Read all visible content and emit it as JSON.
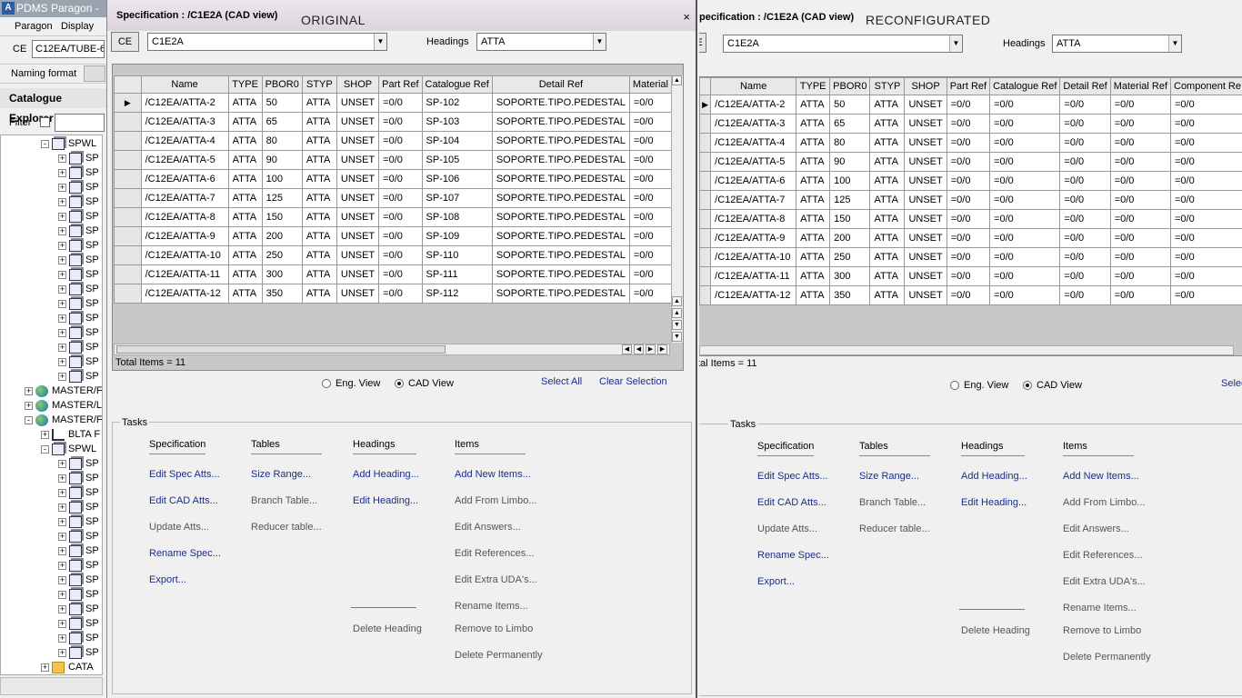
{
  "app": {
    "title": "PDMS Paragon -",
    "logo": "A",
    "menu": [
      "Paragon",
      "Display"
    ],
    "ce_label": "CE",
    "ce_value": "C12EA/TUBE-6",
    "naming_format": "Naming format",
    "explorer_title": "Catalogue Explorer",
    "filter_label": "Filter",
    "tree": [
      {
        "label": "SPWL",
        "level": 2,
        "icon": "spec-icon",
        "sign": "-"
      },
      {
        "label": "SP",
        "level": 3,
        "icon": "spec-icon",
        "sign": "+"
      },
      {
        "label": "SP",
        "level": 3,
        "icon": "spec-icon",
        "sign": "+"
      },
      {
        "label": "SP",
        "level": 3,
        "icon": "spec-icon",
        "sign": "+"
      },
      {
        "label": "SP",
        "level": 3,
        "icon": "spec-icon",
        "sign": "+"
      },
      {
        "label": "SP",
        "level": 3,
        "icon": "spec-icon",
        "sign": "+"
      },
      {
        "label": "SP",
        "level": 3,
        "icon": "spec-icon",
        "sign": "+"
      },
      {
        "label": "SP",
        "level": 3,
        "icon": "spec-icon",
        "sign": "+"
      },
      {
        "label": "SP",
        "level": 3,
        "icon": "spec-icon",
        "sign": "+"
      },
      {
        "label": "SP",
        "level": 3,
        "icon": "spec-icon",
        "sign": "+"
      },
      {
        "label": "SP",
        "level": 3,
        "icon": "spec-icon",
        "sign": "+"
      },
      {
        "label": "SP",
        "level": 3,
        "icon": "spec-icon",
        "sign": "+"
      },
      {
        "label": "SP",
        "level": 3,
        "icon": "spec-icon",
        "sign": "+"
      },
      {
        "label": "SP",
        "level": 3,
        "icon": "spec-icon",
        "sign": "+"
      },
      {
        "label": "SP",
        "level": 3,
        "icon": "spec-icon",
        "sign": "+"
      },
      {
        "label": "SP",
        "level": 3,
        "icon": "spec-icon",
        "sign": "+"
      },
      {
        "label": "SP",
        "level": 3,
        "icon": "spec-icon",
        "sign": "+"
      },
      {
        "label": "MASTER/F",
        "level": 1,
        "icon": "globe-icon",
        "sign": "+"
      },
      {
        "label": "MASTER/L",
        "level": 1,
        "icon": "globe-icon",
        "sign": "+"
      },
      {
        "label": "MASTER/F",
        "level": 1,
        "icon": "globe-icon",
        "sign": "-"
      },
      {
        "label": "BLTA F",
        "level": 2,
        "icon": "hierarchy-icon",
        "sign": "+"
      },
      {
        "label": "SPWL",
        "level": 2,
        "icon": "spec-icon",
        "sign": "-"
      },
      {
        "label": "SP",
        "level": 3,
        "icon": "spec-icon",
        "sign": "+"
      },
      {
        "label": "SP",
        "level": 3,
        "icon": "spec-icon",
        "sign": "+"
      },
      {
        "label": "SP",
        "level": 3,
        "icon": "spec-icon",
        "sign": "+"
      },
      {
        "label": "SP",
        "level": 3,
        "icon": "spec-icon",
        "sign": "+"
      },
      {
        "label": "SP",
        "level": 3,
        "icon": "spec-icon",
        "sign": "+"
      },
      {
        "label": "SP",
        "level": 3,
        "icon": "spec-icon",
        "sign": "+"
      },
      {
        "label": "SP",
        "level": 3,
        "icon": "spec-icon",
        "sign": "+"
      },
      {
        "label": "SP",
        "level": 3,
        "icon": "spec-icon",
        "sign": "+"
      },
      {
        "label": "SP",
        "level": 3,
        "icon": "spec-icon",
        "sign": "+"
      },
      {
        "label": "SP",
        "level": 3,
        "icon": "spec-icon",
        "sign": "+"
      },
      {
        "label": "SP",
        "level": 3,
        "icon": "spec-icon",
        "sign": "+"
      },
      {
        "label": "SP",
        "level": 3,
        "icon": "spec-icon",
        "sign": "+"
      },
      {
        "label": "SP",
        "level": 3,
        "icon": "spec-icon",
        "sign": "+"
      },
      {
        "label": "SP",
        "level": 3,
        "icon": "spec-icon",
        "sign": "+"
      },
      {
        "label": "CATA",
        "level": 2,
        "icon": "folder-icon",
        "sign": "+"
      }
    ]
  },
  "left": {
    "title": "Specification : /C1E2A (CAD view)",
    "overlay": "ORIGINAL",
    "close": "×",
    "ce_button": "CE",
    "spec_value": "C1E2A",
    "headings_label": "Headings",
    "headings_value": "ATTA",
    "columns": [
      "Name",
      "TYPE",
      "PBOR0",
      "STYP",
      "SHOP",
      "Part Ref",
      "Catalogue Ref",
      "Detail Ref",
      "Material"
    ],
    "rows": [
      [
        "/C12EA/ATTA-2",
        "ATTA",
        "50",
        "ATTA",
        "UNSET",
        "=0/0",
        "SP-102",
        "SOPORTE.TIPO.PEDESTAL",
        "=0/0"
      ],
      [
        "/C12EA/ATTA-3",
        "ATTA",
        "65",
        "ATTA",
        "UNSET",
        "=0/0",
        "SP-103",
        "SOPORTE.TIPO.PEDESTAL",
        "=0/0"
      ],
      [
        "/C12EA/ATTA-4",
        "ATTA",
        "80",
        "ATTA",
        "UNSET",
        "=0/0",
        "SP-104",
        "SOPORTE.TIPO.PEDESTAL",
        "=0/0"
      ],
      [
        "/C12EA/ATTA-5",
        "ATTA",
        "90",
        "ATTA",
        "UNSET",
        "=0/0",
        "SP-105",
        "SOPORTE.TIPO.PEDESTAL",
        "=0/0"
      ],
      [
        "/C12EA/ATTA-6",
        "ATTA",
        "100",
        "ATTA",
        "UNSET",
        "=0/0",
        "SP-106",
        "SOPORTE.TIPO.PEDESTAL",
        "=0/0"
      ],
      [
        "/C12EA/ATTA-7",
        "ATTA",
        "125",
        "ATTA",
        "UNSET",
        "=0/0",
        "SP-107",
        "SOPORTE.TIPO.PEDESTAL",
        "=0/0"
      ],
      [
        "/C12EA/ATTA-8",
        "ATTA",
        "150",
        "ATTA",
        "UNSET",
        "=0/0",
        "SP-108",
        "SOPORTE.TIPO.PEDESTAL",
        "=0/0"
      ],
      [
        "/C12EA/ATTA-9",
        "ATTA",
        "200",
        "ATTA",
        "UNSET",
        "=0/0",
        "SP-109",
        "SOPORTE.TIPO.PEDESTAL",
        "=0/0"
      ],
      [
        "/C12EA/ATTA-10",
        "ATTA",
        "250",
        "ATTA",
        "UNSET",
        "=0/0",
        "SP-110",
        "SOPORTE.TIPO.PEDESTAL",
        "=0/0"
      ],
      [
        "/C12EA/ATTA-11",
        "ATTA",
        "300",
        "ATTA",
        "UNSET",
        "=0/0",
        "SP-111",
        "SOPORTE.TIPO.PEDESTAL",
        "=0/0"
      ],
      [
        "/C12EA/ATTA-12",
        "ATTA",
        "350",
        "ATTA",
        "UNSET",
        "=0/0",
        "SP-112",
        "SOPORTE.TIPO.PEDESTAL",
        "=0/0"
      ]
    ],
    "total": "Total Items = 11",
    "eng_view": "Eng. View",
    "cad_view": "CAD View",
    "select_all": "Select All",
    "clear_selection": "Clear Selection"
  },
  "right": {
    "title": "pecification : /C1E2A (CAD view)",
    "overlay": "RECONFIGURATED",
    "ce_button": "E",
    "spec_value": "C1E2A",
    "headings_label": "Headings",
    "headings_value": "ATTA",
    "columns": [
      "Name",
      "TYPE",
      "PBOR0",
      "STYP",
      "SHOP",
      "Part Ref",
      "Catalogue Ref",
      "Detail Ref",
      "Material Ref",
      "Component Re"
    ],
    "rows": [
      [
        "/C12EA/ATTA-2",
        "ATTA",
        "50",
        "ATTA",
        "UNSET",
        "=0/0",
        "=0/0",
        "=0/0",
        "=0/0",
        "=0/0"
      ],
      [
        "/C12EA/ATTA-3",
        "ATTA",
        "65",
        "ATTA",
        "UNSET",
        "=0/0",
        "=0/0",
        "=0/0",
        "=0/0",
        "=0/0"
      ],
      [
        "/C12EA/ATTA-4",
        "ATTA",
        "80",
        "ATTA",
        "UNSET",
        "=0/0",
        "=0/0",
        "=0/0",
        "=0/0",
        "=0/0"
      ],
      [
        "/C12EA/ATTA-5",
        "ATTA",
        "90",
        "ATTA",
        "UNSET",
        "=0/0",
        "=0/0",
        "=0/0",
        "=0/0",
        "=0/0"
      ],
      [
        "/C12EA/ATTA-6",
        "ATTA",
        "100",
        "ATTA",
        "UNSET",
        "=0/0",
        "=0/0",
        "=0/0",
        "=0/0",
        "=0/0"
      ],
      [
        "/C12EA/ATTA-7",
        "ATTA",
        "125",
        "ATTA",
        "UNSET",
        "=0/0",
        "=0/0",
        "=0/0",
        "=0/0",
        "=0/0"
      ],
      [
        "/C12EA/ATTA-8",
        "ATTA",
        "150",
        "ATTA",
        "UNSET",
        "=0/0",
        "=0/0",
        "=0/0",
        "=0/0",
        "=0/0"
      ],
      [
        "/C12EA/ATTA-9",
        "ATTA",
        "200",
        "ATTA",
        "UNSET",
        "=0/0",
        "=0/0",
        "=0/0",
        "=0/0",
        "=0/0"
      ],
      [
        "/C12EA/ATTA-10",
        "ATTA",
        "250",
        "ATTA",
        "UNSET",
        "=0/0",
        "=0/0",
        "=0/0",
        "=0/0",
        "=0/0"
      ],
      [
        "/C12EA/ATTA-11",
        "ATTA",
        "300",
        "ATTA",
        "UNSET",
        "=0/0",
        "=0/0",
        "=0/0",
        "=0/0",
        "=0/0"
      ],
      [
        "/C12EA/ATTA-12",
        "ATTA",
        "350",
        "ATTA",
        "UNSET",
        "=0/0",
        "=0/0",
        "=0/0",
        "=0/0",
        "=0/0"
      ]
    ],
    "total": "tal Items = 11",
    "eng_view": "Eng. View",
    "cad_view": "CAD View",
    "select_all": "Selec"
  },
  "tasks": {
    "title": "Tasks",
    "headers": {
      "spec": "Specification",
      "tables": "Tables",
      "headings": "Headings",
      "items": "Items"
    },
    "spec": [
      "Edit Spec Atts...",
      "Edit CAD Atts...",
      "Update Atts...",
      "Rename Spec...",
      "Export..."
    ],
    "tables": [
      "Size Range...",
      "Branch Table...",
      "Reducer table..."
    ],
    "headings": [
      "Add Heading...",
      "Edit Heading...",
      "Delete Heading"
    ],
    "items": [
      "Add New Items...",
      "Add From Limbo...",
      "Edit Answers...",
      "Edit References...",
      "Edit Extra UDA's...",
      "Rename Items...",
      "Remove to Limbo",
      "Delete Permanently"
    ]
  }
}
